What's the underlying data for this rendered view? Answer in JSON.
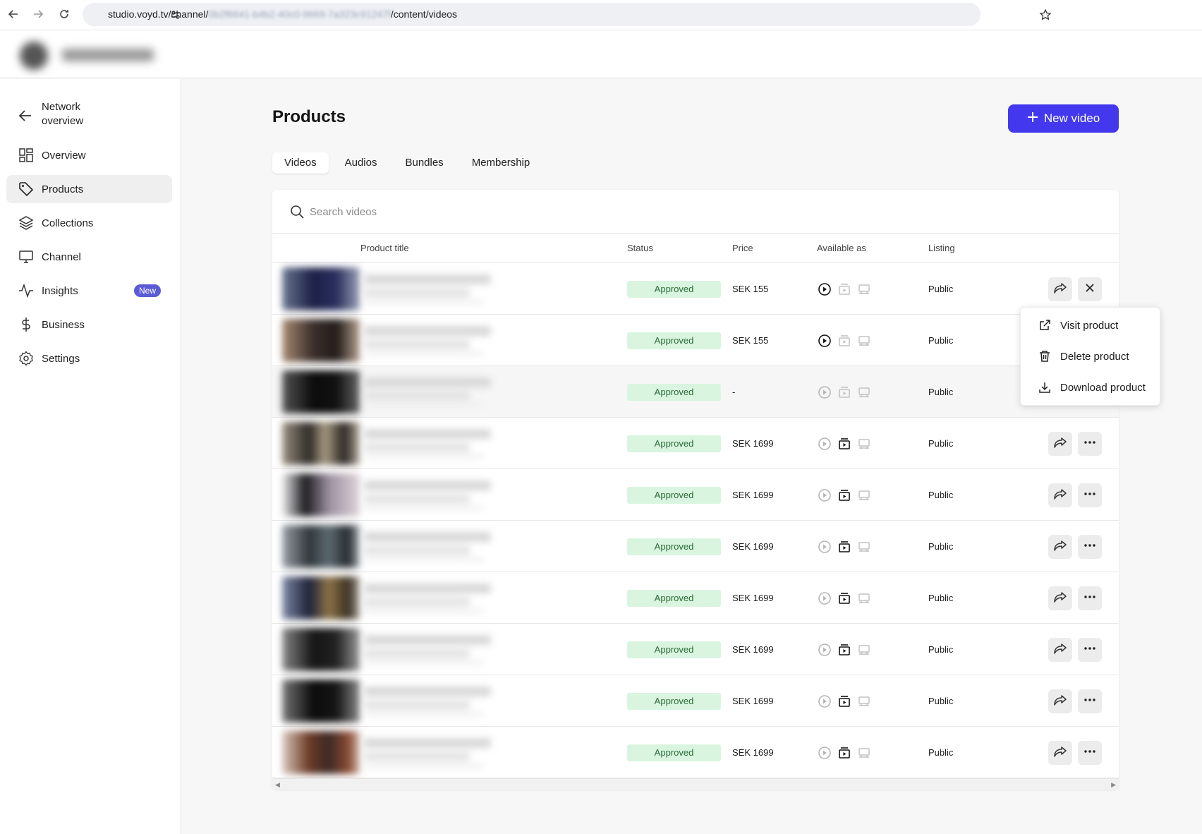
{
  "browser": {
    "url_prefix": "studio.voyd.tv/channel/",
    "url_redacted": "0b2f6641-b4b2-40c0-9669-7a323c91247f",
    "url_suffix": "/content/videos"
  },
  "sidebar": {
    "back_label": "Network overview",
    "items": [
      {
        "label": "Overview",
        "icon": "grid-icon"
      },
      {
        "label": "Products",
        "icon": "tag-icon"
      },
      {
        "label": "Collections",
        "icon": "layers-icon"
      },
      {
        "label": "Channel",
        "icon": "monitor-icon"
      },
      {
        "label": "Insights",
        "icon": "activity-icon",
        "badge": "New"
      },
      {
        "label": "Business",
        "icon": "dollar-icon"
      },
      {
        "label": "Settings",
        "icon": "gear-icon"
      }
    ]
  },
  "main": {
    "title": "Products",
    "new_button": "New video",
    "tabs": [
      "Videos",
      "Audios",
      "Bundles",
      "Membership"
    ],
    "search_placeholder": "Search videos",
    "columns": {
      "product_title": "Product title",
      "status": "Status",
      "price": "Price",
      "available_as": "Available as",
      "listing": "Listing"
    },
    "rows": [
      {
        "status": "Approved",
        "price": "SEK 155",
        "listing": "Public"
      },
      {
        "status": "Approved",
        "price": "SEK 155",
        "listing": "Public"
      },
      {
        "status": "Approved",
        "price": "-",
        "listing": "Public"
      },
      {
        "status": "Approved",
        "price": "SEK 1699",
        "listing": "Public"
      },
      {
        "status": "Approved",
        "price": "SEK 1699",
        "listing": "Public"
      },
      {
        "status": "Approved",
        "price": "SEK 1699",
        "listing": "Public"
      },
      {
        "status": "Approved",
        "price": "SEK 1699",
        "listing": "Public"
      },
      {
        "status": "Approved",
        "price": "SEK 1699",
        "listing": "Public"
      },
      {
        "status": "Approved",
        "price": "SEK 1699",
        "listing": "Public"
      },
      {
        "status": "Approved",
        "price": "SEK 1699",
        "listing": "Public"
      }
    ]
  },
  "menu": {
    "items": [
      "Visit product",
      "Delete product",
      "Download product"
    ]
  },
  "colors": {
    "accent": "#4338ee",
    "status_bg": "#d9f5df",
    "status_text": "#2c6b3a"
  }
}
